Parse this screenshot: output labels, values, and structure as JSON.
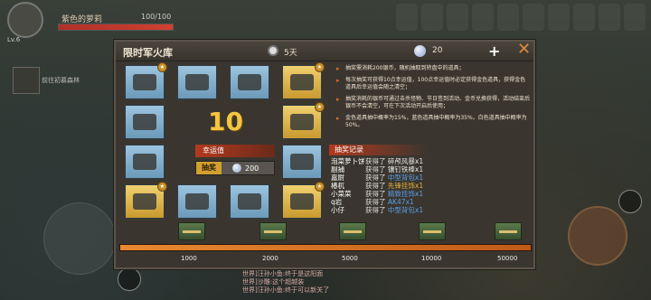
{
  "player": {
    "name": "紫色的萝莉",
    "hp": "100/100",
    "hp_fraction": 1.0,
    "level": "Lv.6"
  },
  "map_label": "前往初慕森林",
  "top_icons": [
    "",
    "",
    "",
    "",
    "",
    "",
    "",
    "",
    "",
    ""
  ],
  "modal": {
    "title": "限时军火库",
    "timer": "5天",
    "coins": "20",
    "plus": "+",
    "close": "✕",
    "luck_value": "10",
    "luck_label": "幸运值",
    "draw_label": "抽奖",
    "draw_cost": "200",
    "rules": [
      "抽奖需消耗200银币，随机抽取到转盘中的道具；",
      "每次抽奖可获得10点幸运值，100点幸运值时必定获得金色道具，获得金色道具后幸运值会随之清空；",
      "抽奖消耗的银币可通过击杀怪物、节日签到活动、金币兑换获得，活动结束后银币不会清空，可在下次活动开启后使用；",
      "金色道具抽中概率为15%，蓝色道具抽中概率为35%，白色道具抽中概率为50%。"
    ],
    "log_title": "抽奖记录",
    "log": [
      {
        "user": "泡菜萝卜饼",
        "got": "获得了",
        "item": "碎颅风暴x1",
        "rarity": "white"
      },
      {
        "user": "副捕",
        "got": "获得了",
        "item": "镶钉铁棒x1",
        "rarity": "white"
      },
      {
        "user": "嘉尉",
        "got": "获得了",
        "item": "中型背包x1",
        "rarity": "blue"
      },
      {
        "user": "椿杌",
        "got": "获得了",
        "item": "先锋挂饰x1",
        "rarity": "gold"
      },
      {
        "user": "小菜菜",
        "got": "获得了",
        "item": "精致挂饰x1",
        "rarity": "blue"
      },
      {
        "user": "q岩",
        "got": "获得了",
        "item": "AK47x1",
        "rarity": "blue"
      },
      {
        "user": "小仔",
        "got": "获得了",
        "item": "中型背包x1",
        "rarity": "blue"
      }
    ],
    "milestones": [
      "1000",
      "2000",
      "5000",
      "10000",
      "50000"
    ],
    "progress_fraction": 1.0
  },
  "chat": [
    "世界]汪孙小鱼:终于是这阳面",
    "世界]沙雕:这个超越装",
    "世界]汪孙小鱼:终于可以新关了"
  ],
  "colors": {
    "accent": "#e8b23a",
    "blue_item": "#5c9ee6",
    "close": "#e08a3c",
    "hp": "#c03428"
  }
}
